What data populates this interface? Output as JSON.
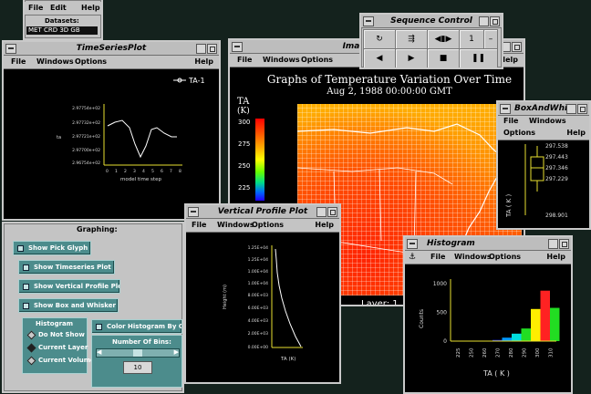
{
  "dataset_window": {
    "menu": [
      "File",
      "Edit",
      "Help"
    ],
    "label": "Datasets:",
    "item": "MET CRD 3D GB"
  },
  "timeseries": {
    "title": "TimeSeriesPlot",
    "menu": [
      "File",
      "Windows",
      "Options",
      "Help"
    ],
    "legend": "TA-1",
    "y_ticks": [
      "2.97754e+02",
      "2.97732e+02",
      "2.97721e+02",
      "2.97700e+02",
      "2.96754e+02"
    ],
    "ylabel": "ta",
    "xlabel": "model time step",
    "x_ticks": [
      "0",
      "1",
      "2",
      "3",
      "4",
      "5",
      "6",
      "7",
      "8"
    ]
  },
  "image_window": {
    "title": "Image Window",
    "menu": [
      "File",
      "Windows",
      "Options",
      "Help"
    ],
    "heading": "Graphs of Temperature Variation Over Time",
    "subheading": "Aug 2, 1988  00:00:00 GMT",
    "scale_title_1": "TA",
    "scale_title_2": "(K)",
    "scale_values": [
      "300",
      "275",
      "250",
      "225"
    ],
    "layer_label": "Layer: 1"
  },
  "sequence_control": {
    "title": "Sequence Control",
    "step_value": "1",
    "buttons": [
      "loop-icon",
      "speed-icon",
      "step-icon",
      "back-icon",
      "play-icon",
      "stop-icon",
      "pause-icon"
    ]
  },
  "boxwhisk": {
    "title": "BoxAndWhisk",
    "menu": [
      "File",
      "Windows",
      "Options",
      "Help"
    ],
    "values": [
      "297.538",
      "297.443",
      "297.346",
      "297.229",
      "298.901"
    ],
    "ylabel": "TA ( K )"
  },
  "graphing": {
    "title": "Graphing:",
    "buttons": [
      "Show Pick Glyph",
      "Show Timeseries Plot",
      "Show Vertical Profile Plot",
      "Show Box and Whisker Plot"
    ],
    "histogram_label": "Histogram",
    "radios": [
      "Do Not Show",
      "Current Layer",
      "Current Volume"
    ],
    "color_toggle": "Color Histogram By Counts",
    "bins_label": "Number Of Bins:",
    "bins_value": "10"
  },
  "vertical_profile": {
    "title": "Vertical Profile Plot",
    "menu": [
      "File",
      "Windows",
      "Options",
      "Help"
    ],
    "y_ticks": [
      "1.25E+04",
      "1.25E+04",
      "1.00E+04",
      "1.00E+04",
      "8.00E+03",
      "6.00E+03",
      "4.00E+03",
      "2.00E+03",
      "0.00E+00"
    ],
    "ylabel": "Height (m)",
    "xlabel": "TA (K)"
  },
  "histogram": {
    "title": "Histogram",
    "menu": [
      "File",
      "Windows",
      "Options",
      "Help"
    ]
  },
  "chart_data": {
    "type": "bar",
    "categories": [
      "250",
      "260",
      "270",
      "280",
      "290",
      "300",
      "310"
    ],
    "values": [
      20,
      60,
      130,
      220,
      560,
      880,
      580
    ],
    "colors": [
      "#2233ff",
      "#0099ff",
      "#00dddd",
      "#22dd22",
      "#ffee00",
      "#ff2222",
      "#22dd22"
    ],
    "y_ticks": [
      "0",
      "500",
      "1000"
    ],
    "ylim": [
      0,
      1050
    ],
    "x_ticks": [
      "225",
      "250",
      "260",
      "270",
      "280",
      "290",
      "300",
      "310"
    ],
    "xlabel": "TA ( K )",
    "ylabel": "Counts"
  }
}
